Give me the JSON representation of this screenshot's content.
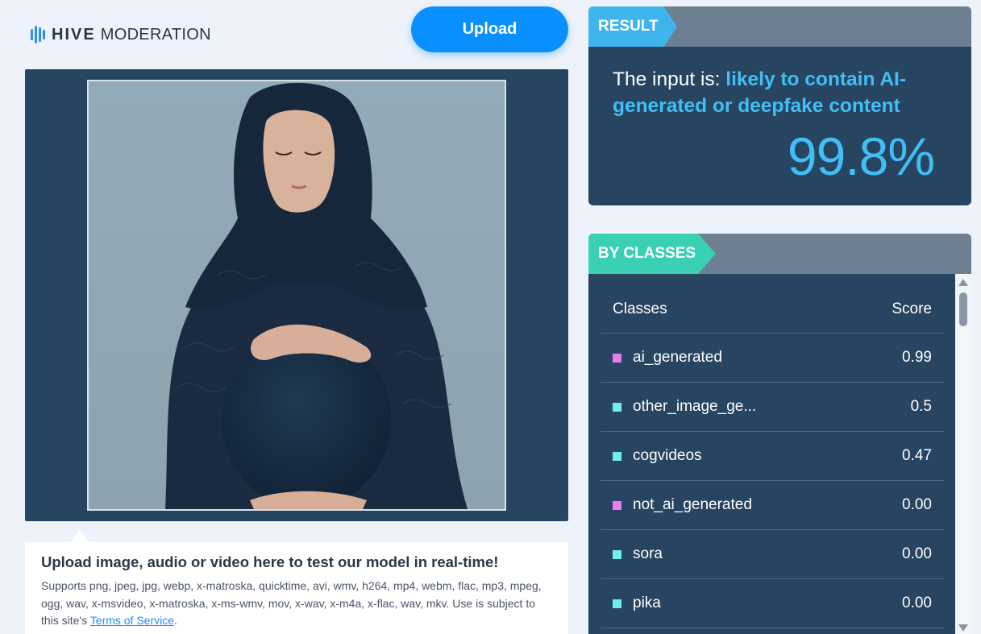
{
  "brand": {
    "name_bold": "HIVE",
    "name_light": "MODERATION",
    "icon": "hive-logo-icon"
  },
  "header": {
    "upload_label": "Upload"
  },
  "preview": {
    "image_alt": "uploaded image preview"
  },
  "info": {
    "title": "Upload image, audio or video here to test our model in real-time!",
    "supports_text": "Supports png, jpeg, jpg, webp, x-matroska, quicktime, avi, wmv, h264, mp4, webm, flac, mp3, mpeg, ogg, wav, x-msvideo, x-matroska, x-ms-wmv, mov, x-wav, x-m4a, x-flac, wav, mkv. Use is subject to this site's ",
    "terms_link": "Terms of Service",
    "terms_suffix": "."
  },
  "result": {
    "tag": "RESULT",
    "prefix": "The input is: ",
    "verdict": "likely to contain AI-generated or deepfake content",
    "percent": "99.8%"
  },
  "classes": {
    "tag": "BY CLASSES",
    "col_classes": "Classes",
    "col_score": "Score",
    "rows": [
      {
        "name": "ai_generated",
        "score": "0.99",
        "color": "#e77ef0"
      },
      {
        "name": "other_image_ge...",
        "score": "0.5",
        "color": "#6ef0e6"
      },
      {
        "name": "cogvideos",
        "score": "0.47",
        "color": "#6ef0e6"
      },
      {
        "name": "not_ai_generated",
        "score": "0.00",
        "color": "#e77ef0"
      },
      {
        "name": "sora",
        "score": "0.00",
        "color": "#6ef0e6"
      },
      {
        "name": "pika",
        "score": "0.00",
        "color": "#6ef0e6"
      }
    ]
  },
  "colors": {
    "accent": "#0a8fff",
    "panel": "#274560",
    "highlight": "#3fbff5",
    "class_tag": "#39d0b4"
  }
}
